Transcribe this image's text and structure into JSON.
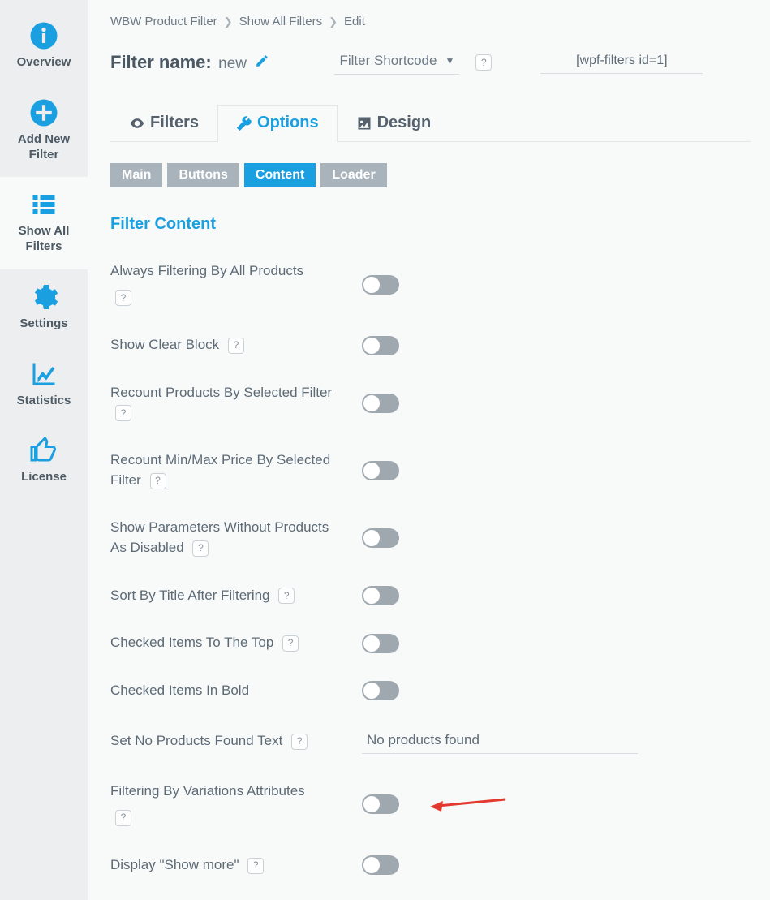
{
  "sidebar": {
    "items": [
      {
        "label": "Overview"
      },
      {
        "label": "Add New Filter"
      },
      {
        "label": "Show All Filters"
      },
      {
        "label": "Settings"
      },
      {
        "label": "Statistics"
      },
      {
        "label": "License"
      }
    ]
  },
  "breadcrumb": [
    "WBW Product Filter",
    "Show All Filters",
    "Edit"
  ],
  "header": {
    "name_label": "Filter name:",
    "name_value": "new",
    "shortcode_select": "Filter Shortcode",
    "shortcode_value": "[wpf-filters id=1]"
  },
  "top_tabs": [
    "Filters",
    "Options",
    "Design"
  ],
  "sub_tabs": [
    "Main",
    "Buttons",
    "Content",
    "Loader"
  ],
  "section_title": "Filter Content",
  "options": [
    {
      "label": "Always Filtering By All Products",
      "help_below": true
    },
    {
      "label": "Show Clear Block",
      "help_inline": true
    },
    {
      "label": "Recount Products By Selected Filter",
      "help_inline": true
    },
    {
      "label": "Recount Min/Max Price By Selected Filter",
      "help_inline": true
    },
    {
      "label": "Show Parameters Without Products As Disabled",
      "help_inline": true
    },
    {
      "label": "Sort By Title After Filtering",
      "help_inline": true
    },
    {
      "label": "Checked Items To The Top",
      "help_inline": true
    },
    {
      "label": "Checked Items In Bold"
    },
    {
      "label": "Set No Products Found Text",
      "help_inline": true,
      "input_value": "No products found"
    },
    {
      "label": "Filtering By Variations Attributes",
      "help_below": true,
      "arrow": true
    },
    {
      "label": "Display \"Show more\"",
      "help_inline": true
    }
  ]
}
